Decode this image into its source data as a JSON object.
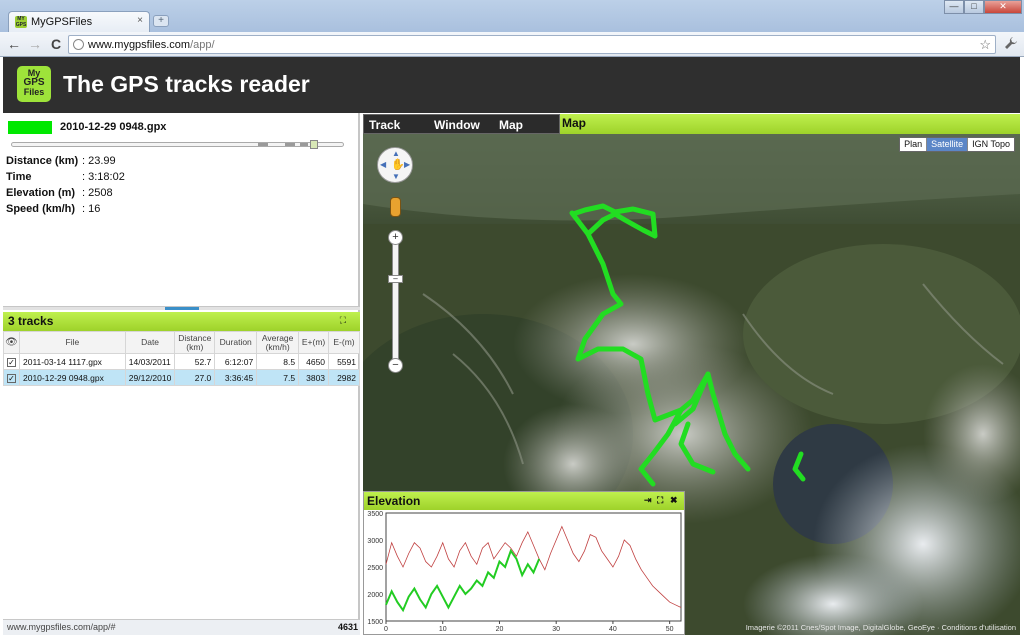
{
  "browser": {
    "tab_title": "MyGPSFiles",
    "tab_close": "×",
    "new_tab": "+",
    "url_host": "www.mygpsfiles.com",
    "url_path": "/app/",
    "back": "←",
    "forward": "→",
    "reload": "C",
    "minimize": "—",
    "maximize": "□",
    "close": "✕",
    "bookmark": "☆",
    "wrench": "🔧"
  },
  "header": {
    "logo_lines": [
      "My",
      "GPS",
      "Files"
    ],
    "title": "The GPS tracks reader"
  },
  "current_track": {
    "name": "2010-12-29 0948.gpx",
    "color": "#00e800",
    "stats": [
      {
        "label": "Distance (km)",
        "value": ": 23.99"
      },
      {
        "label": "Time",
        "value": ": 3:18:02"
      },
      {
        "label": "Elevation (m)",
        "value": ": 2508"
      },
      {
        "label": "Speed (km/h)",
        "value": ": 16"
      }
    ]
  },
  "tracks_panel": {
    "title": "3 tracks",
    "columns": [
      "File",
      "Date",
      "Distance (km)",
      "Duration",
      "Average (km/h)",
      "E+(m)",
      "E-(m)"
    ],
    "rows": [
      {
        "file": "2011-03-14 1117.gpx",
        "date": "14/03/2011",
        "distance": "52.7",
        "duration": "6:12:07",
        "average": "8.5",
        "eplus": "4650",
        "eminus": "5591",
        "checked": true,
        "selected": false
      },
      {
        "file": "2010-12-29 0948.gpx",
        "date": "29/12/2010",
        "distance": "27.0",
        "duration": "3:36:45",
        "average": "7.5",
        "eplus": "3803",
        "eminus": "2982",
        "checked": true,
        "selected": true
      }
    ]
  },
  "status": {
    "url": "www.mygpsfiles.com/app/#",
    "count": "4631"
  },
  "menu": [
    "Track",
    "Window",
    "Map"
  ],
  "map": {
    "title": "Map",
    "types": [
      "Plan",
      "Satellite",
      "IGN Topo"
    ],
    "active_type": "Satellite",
    "attribution": "Imagerie ©2011 Cnes/Spot Image, DigitalGlobe, GeoEye · Conditions d'utilisation",
    "track_color": "#22dd22"
  },
  "elevation": {
    "title": "Elevation",
    "y_ticks": [
      "3500",
      "3000",
      "2500",
      "2000",
      "1500"
    ],
    "x_ticks": [
      "0",
      "10",
      "20",
      "30",
      "40",
      "50"
    ]
  },
  "chart_data": {
    "type": "line",
    "xlim": [
      0,
      52
    ],
    "ylim": [
      1500,
      3500
    ],
    "series": [
      {
        "color": "#c04040",
        "x": [
          0,
          1,
          2,
          3,
          4,
          5,
          6,
          7,
          8,
          9,
          10,
          11,
          12,
          13,
          14,
          15,
          16,
          17,
          18,
          19,
          20,
          21,
          22,
          23,
          24,
          25,
          26,
          27,
          28,
          29,
          30,
          31,
          32,
          33,
          34,
          35,
          36,
          37,
          38,
          39,
          40,
          41,
          42,
          43,
          44,
          45,
          46,
          47,
          48,
          49,
          50,
          51,
          52
        ],
        "values": [
          2550,
          2950,
          2700,
          2500,
          2750,
          2950,
          2850,
          2600,
          2500,
          2700,
          2950,
          2650,
          2500,
          2800,
          2950,
          2700,
          2550,
          2850,
          2950,
          2650,
          2800,
          2950,
          2850,
          2700,
          2950,
          3150,
          2900,
          2650,
          2450,
          2750,
          3000,
          3250,
          3000,
          2750,
          2600,
          2800,
          3100,
          3050,
          2800,
          2650,
          2500,
          2700,
          3000,
          2900,
          2650,
          2450,
          2300,
          2150,
          2050,
          1950,
          1850,
          1800,
          1750
        ]
      },
      {
        "color": "#22cc22",
        "x": [
          0,
          1,
          2,
          3,
          4,
          5,
          6,
          7,
          8,
          9,
          10,
          11,
          12,
          13,
          14,
          15,
          16,
          17,
          18,
          19,
          20,
          21,
          22,
          23,
          24,
          25,
          26,
          27
        ],
        "values": [
          1800,
          2050,
          1850,
          1700,
          1950,
          2100,
          1900,
          1750,
          2000,
          2150,
          1950,
          1750,
          1950,
          2150,
          2000,
          2100,
          2250,
          2150,
          2400,
          2300,
          2600,
          2500,
          2800,
          2650,
          2350,
          2550,
          2400,
          2650
        ]
      }
    ]
  }
}
